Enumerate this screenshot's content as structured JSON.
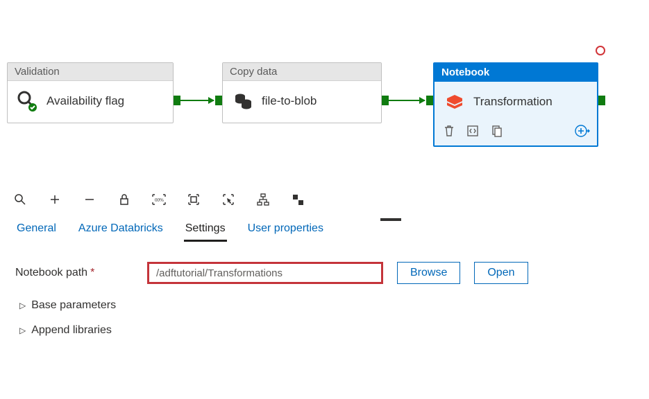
{
  "activities": {
    "validation": {
      "type": "Validation",
      "name": "Availability flag"
    },
    "copy": {
      "type": "Copy data",
      "name": "file-to-blob"
    },
    "notebook": {
      "type": "Notebook",
      "name": "Transformation"
    }
  },
  "tabs": {
    "general": "General",
    "databricks": "Azure Databricks",
    "settings": "Settings",
    "userprops": "User properties"
  },
  "settings": {
    "notebook_path_label": "Notebook path",
    "notebook_path_value": "/adftutorial/Transformations",
    "browse_label": "Browse",
    "open_label": "Open",
    "base_params_label": "Base parameters",
    "append_libs_label": "Append libraries"
  }
}
